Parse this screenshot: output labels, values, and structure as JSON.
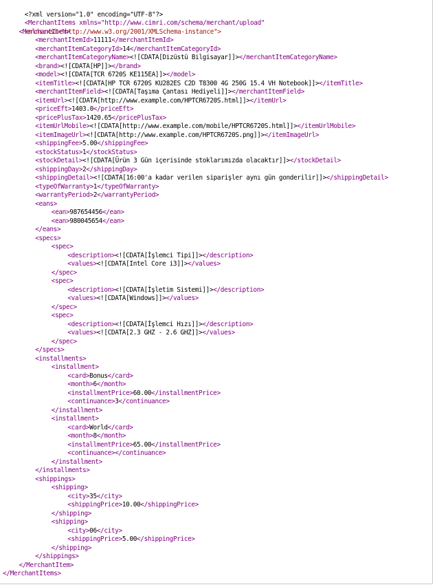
{
  "colors": {
    "tag": "#800080",
    "attribute": "#a31515",
    "value": "#0000ff",
    "text": "#000000"
  },
  "xml": {
    "declaration": "<?xml version=\"1.0\" encoding=\"UTF-8\"?>",
    "root_open_line1": "<MerchantItems xmlns=\"http://www.cimri.com/schema/merchant/upload\"",
    "root_open_line2": "xmlns:xsi=\"http://www.w3.org/2001/XMLSchema-instance\">",
    "lines": [
      {
        "indent": 1,
        "text": "<MerchantItem>"
      },
      {
        "indent": 2,
        "text": "<merchantItemId>11111</merchantItemId>"
      },
      {
        "indent": 2,
        "text": "<merchantItemCategoryId>14</merchantItemCategoryId>"
      },
      {
        "indent": 2,
        "text": "<merchantItemCategoryName><![CDATA[Dizüstü Bilgisayar]]></merchantItemCategoryName>"
      },
      {
        "indent": 2,
        "text": "<brand><![CDATA[HP]]></brand>"
      },
      {
        "indent": 2,
        "text": "<model><![CDATA[TCR 6720S KE115EA]]></model>"
      },
      {
        "indent": 2,
        "text": "<itemTitle><![CDATA[HP TCR 6720S KU282ES C2D T8300 4G 250G 15.4 VH Notebook]]></itemTitle>"
      },
      {
        "indent": 2,
        "text": "<merchantItemField><![CDATA[Taşıma Çantası Hediyeli]]></merchantItemField>"
      },
      {
        "indent": 2,
        "text": "<itemUrl><![CDATA[http://www.example.com/HPTCR6720S.html]]></itemUrl>"
      },
      {
        "indent": 2,
        "text": "<priceEft>1403.0</priceEft>"
      },
      {
        "indent": 2,
        "text": "<pricePlusTax>1420.65</pricePlusTax>"
      },
      {
        "indent": 2,
        "text": "<itemUrlMobile><![CDATA[http://www.example.com/mobile/HPTCR6720S.html]]></itemUrlMobile>"
      },
      {
        "indent": 2,
        "text": "<itemImageUrl><![CDATA[http://www.example.com/HPTCR6720S.png]]></itemImageUrl>"
      },
      {
        "indent": 2,
        "text": "<shippingFee>5.00</shippingFee>"
      },
      {
        "indent": 2,
        "text": "<stockStatus>1</stockStatus>"
      },
      {
        "indent": 2,
        "text": "<stockDetail><![CDATA[Ürün 3 Gün içerisinde stoklarımızda olacaktır]]></stockDetail>"
      },
      {
        "indent": 2,
        "text": "<shippingDay>2</shippingDay>"
      },
      {
        "indent": 2,
        "text": "<shippingDetail><![CDATA[16:00'a kadar verilen siparişler aynı gün gonderilir]]></shippingDetail>"
      },
      {
        "indent": 2,
        "text": "<typeOfWarranty>1</typeOfWarranty>"
      },
      {
        "indent": 2,
        "text": "<warrantyPeriod>2</warrantyPeriod>"
      },
      {
        "indent": 2,
        "text": "<eans>"
      },
      {
        "indent": 3,
        "text": "<ean>987654456</ean>"
      },
      {
        "indent": 3,
        "text": "<ean>980045654</ean>"
      },
      {
        "indent": 2,
        "text": "</eans>"
      },
      {
        "indent": 2,
        "text": "<specs>"
      },
      {
        "indent": 3,
        "text": "<spec>"
      },
      {
        "indent": 4,
        "text": "<description><![CDATA[İşlemci Tipi]]></description>"
      },
      {
        "indent": 4,
        "text": "<values><![CDATA[Intel Core i3]]></values>"
      },
      {
        "indent": 3,
        "text": "</spec>"
      },
      {
        "indent": 3,
        "text": "<spec>"
      },
      {
        "indent": 4,
        "text": "<description><![CDATA[İşletim Sistemi]]></description>"
      },
      {
        "indent": 4,
        "text": "<values><![CDATA[Windows]]></values>"
      },
      {
        "indent": 3,
        "text": "</spec>"
      },
      {
        "indent": 3,
        "text": "<spec>"
      },
      {
        "indent": 4,
        "text": "<description><![CDATA[İşlemci Hızı]]></description>"
      },
      {
        "indent": 4,
        "text": "<values><![CDATA[2.3 GHZ - 2.6 GHZ]]></values>"
      },
      {
        "indent": 3,
        "text": "</spec>"
      },
      {
        "indent": 2,
        "text": "</specs>"
      },
      {
        "indent": 2,
        "text": "<installments>"
      },
      {
        "indent": 3,
        "text": "<installment>"
      },
      {
        "indent": 4,
        "text": "<card>Bonus</card>"
      },
      {
        "indent": 4,
        "text": "<month>6</month>"
      },
      {
        "indent": 4,
        "text": "<installmentPrice>60.00</installmentPrice>"
      },
      {
        "indent": 4,
        "text": "<continuance>3</continuance>"
      },
      {
        "indent": 3,
        "text": "</installment>"
      },
      {
        "indent": 3,
        "text": "<installment>"
      },
      {
        "indent": 4,
        "text": "<card>World</card>"
      },
      {
        "indent": 4,
        "text": "<month>8</month>"
      },
      {
        "indent": 4,
        "text": "<installmentPrice>65.00</installmentPrice>"
      },
      {
        "indent": 4,
        "text": "<continuance></continuance>"
      },
      {
        "indent": 3,
        "text": "</installment>"
      },
      {
        "indent": 2,
        "text": "</installments>"
      },
      {
        "indent": 2,
        "text": "<shippings>"
      },
      {
        "indent": 3,
        "text": "<shipping>"
      },
      {
        "indent": 4,
        "text": "<city>35</city>"
      },
      {
        "indent": 4,
        "text": "<shippingPrice>10.00</shippingPrice>"
      },
      {
        "indent": 3,
        "text": "</shipping>"
      },
      {
        "indent": 3,
        "text": "<shipping>"
      },
      {
        "indent": 4,
        "text": "<city>06</city>"
      },
      {
        "indent": 4,
        "text": "<shippingPrice>5.00</shippingPrice>"
      },
      {
        "indent": 3,
        "text": "</shipping>"
      },
      {
        "indent": 2,
        "text": "</shippings>"
      },
      {
        "indent": 1,
        "text": "</MerchantItem>"
      },
      {
        "indent": 0,
        "text": "</MerchantItems>"
      }
    ]
  }
}
